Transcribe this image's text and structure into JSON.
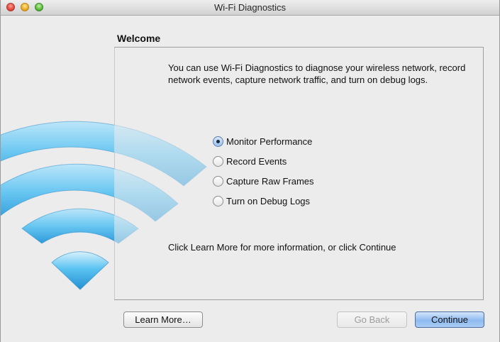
{
  "window": {
    "title": "Wi-Fi Diagnostics"
  },
  "section": {
    "title": "Welcome"
  },
  "intro": {
    "text": "You can use Wi-Fi Diagnostics to diagnose your wireless network, record network events, capture network traffic, and turn on debug logs."
  },
  "options": [
    {
      "label": "Monitor Performance",
      "selected": true
    },
    {
      "label": "Record Events",
      "selected": false
    },
    {
      "label": "Capture Raw Frames",
      "selected": false
    },
    {
      "label": "Turn on Debug Logs",
      "selected": false
    }
  ],
  "footnote": {
    "text": "Click Learn More for more information, or click Continue"
  },
  "buttons": {
    "learn_more": "Learn More…",
    "go_back": "Go Back",
    "continue": "Continue"
  },
  "colors": {
    "wifi_blue": "#2fa8e8",
    "default_button": "#8fbaf0"
  }
}
